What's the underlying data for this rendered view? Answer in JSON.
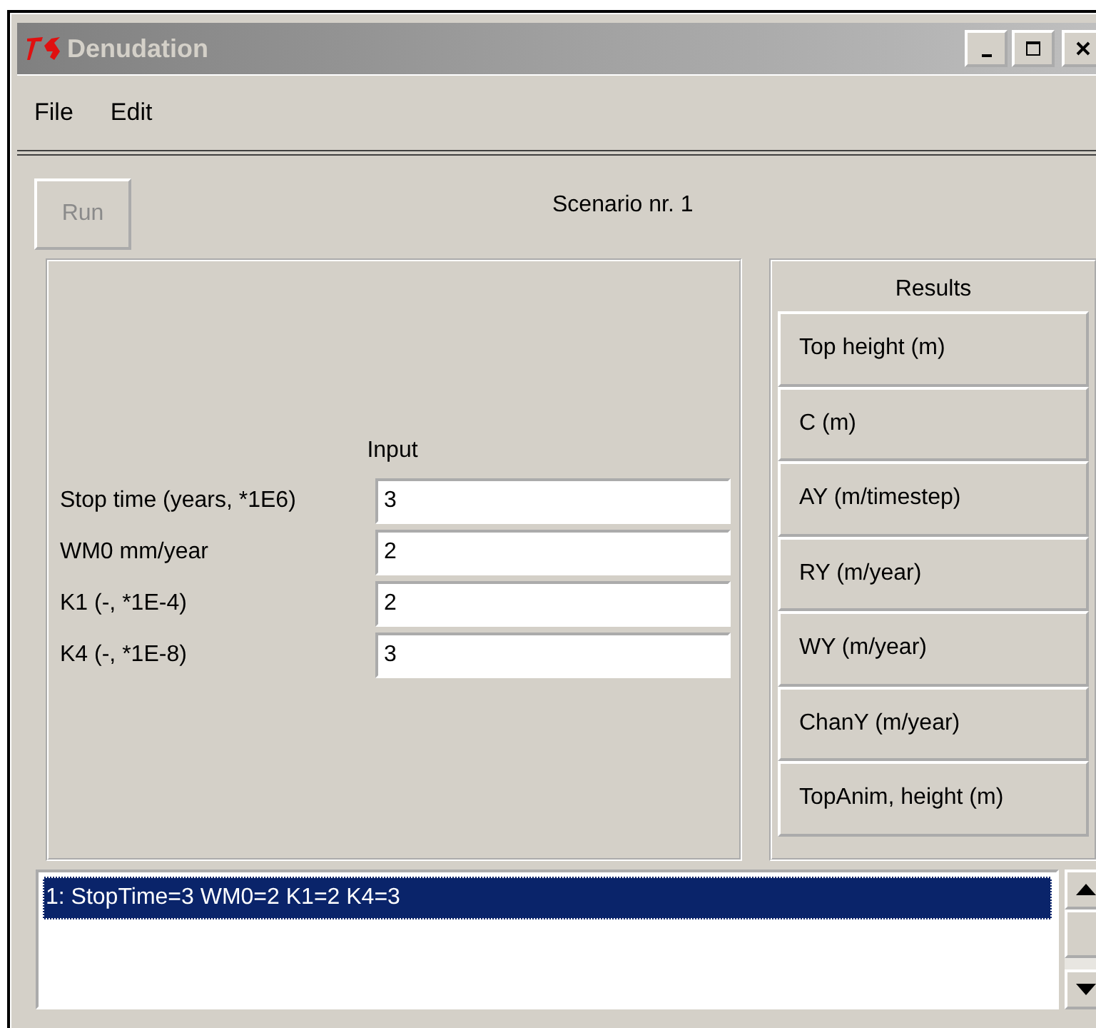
{
  "window": {
    "title": "Denudation"
  },
  "menu": [
    {
      "label": "File"
    },
    {
      "label": "Edit"
    }
  ],
  "run_button": {
    "label": "Run",
    "disabled": true
  },
  "scenario_label": "Scenario nr. 1",
  "input": {
    "title": "Input",
    "fields": [
      {
        "label": "Stop time (years, *1E6)",
        "value": "3"
      },
      {
        "label": "WM0 mm/year",
        "value": "2"
      },
      {
        "label": "K1 (-, *1E-4)",
        "value": "2"
      },
      {
        "label": "K4 (-, *1E-8)",
        "value": "3"
      }
    ]
  },
  "results": {
    "title": "Results",
    "buttons": [
      {
        "label": "Top height (m)"
      },
      {
        "label": "C (m)"
      },
      {
        "label": "AY (m/timestep)"
      },
      {
        "label": "RY (m/year)"
      },
      {
        "label": "WY (m/year)"
      },
      {
        "label": "ChanY (m/year)"
      },
      {
        "label": "TopAnim, height (m)"
      }
    ]
  },
  "log": {
    "items": [
      {
        "text": "1: StopTime=3 WM0=2 K1=2 K4=3",
        "selected": true
      }
    ]
  }
}
